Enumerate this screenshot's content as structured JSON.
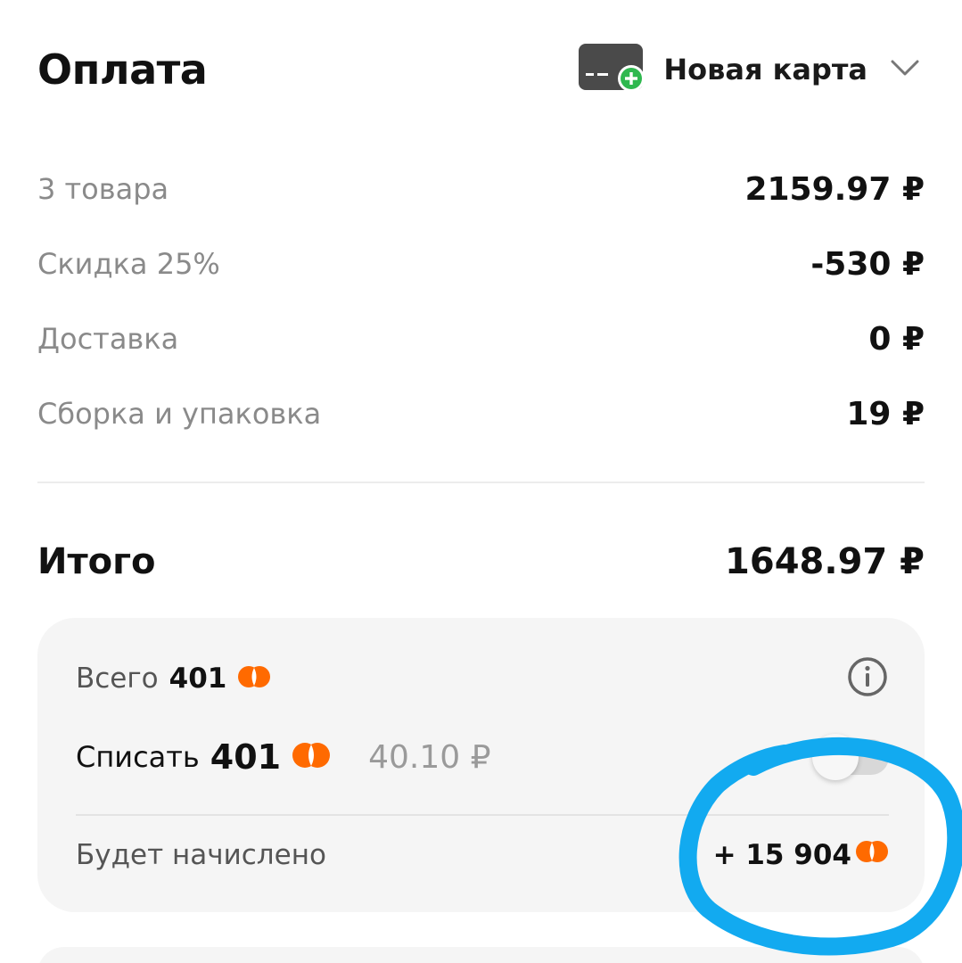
{
  "header": {
    "title": "Оплата",
    "card_label": "Новая карта",
    "card_icon": "add-card-icon",
    "chevron_icon": "chevron-down-icon"
  },
  "summary": {
    "rows": [
      {
        "label": "3 товара",
        "value": "2159.97 ₽"
      },
      {
        "label": "Скидка 25%",
        "value": "-530 ₽"
      },
      {
        "label": "Доставка",
        "value": "0 ₽"
      },
      {
        "label": "Сборка и упаковка",
        "value": "19 ₽"
      }
    ],
    "total_label": "Итого",
    "total_value": "1648.97 ₽"
  },
  "bonuses": {
    "total_label": "Всего",
    "total_value": "401",
    "writeoff_label": "Списать",
    "writeoff_value": "401",
    "writeoff_rub": "40.10 ₽",
    "writeoff_toggle_on": false,
    "accrual_label": "Будет начислено",
    "accrual_value": "+ 15 904",
    "info_icon": "info-icon",
    "coin_icon": "bonus-coin-icon"
  },
  "colors": {
    "accent_orange": "#ff6a00",
    "add_green": "#2fb84f",
    "card_dark": "#4a4a4a",
    "annotation_blue": "#12aaf0"
  }
}
